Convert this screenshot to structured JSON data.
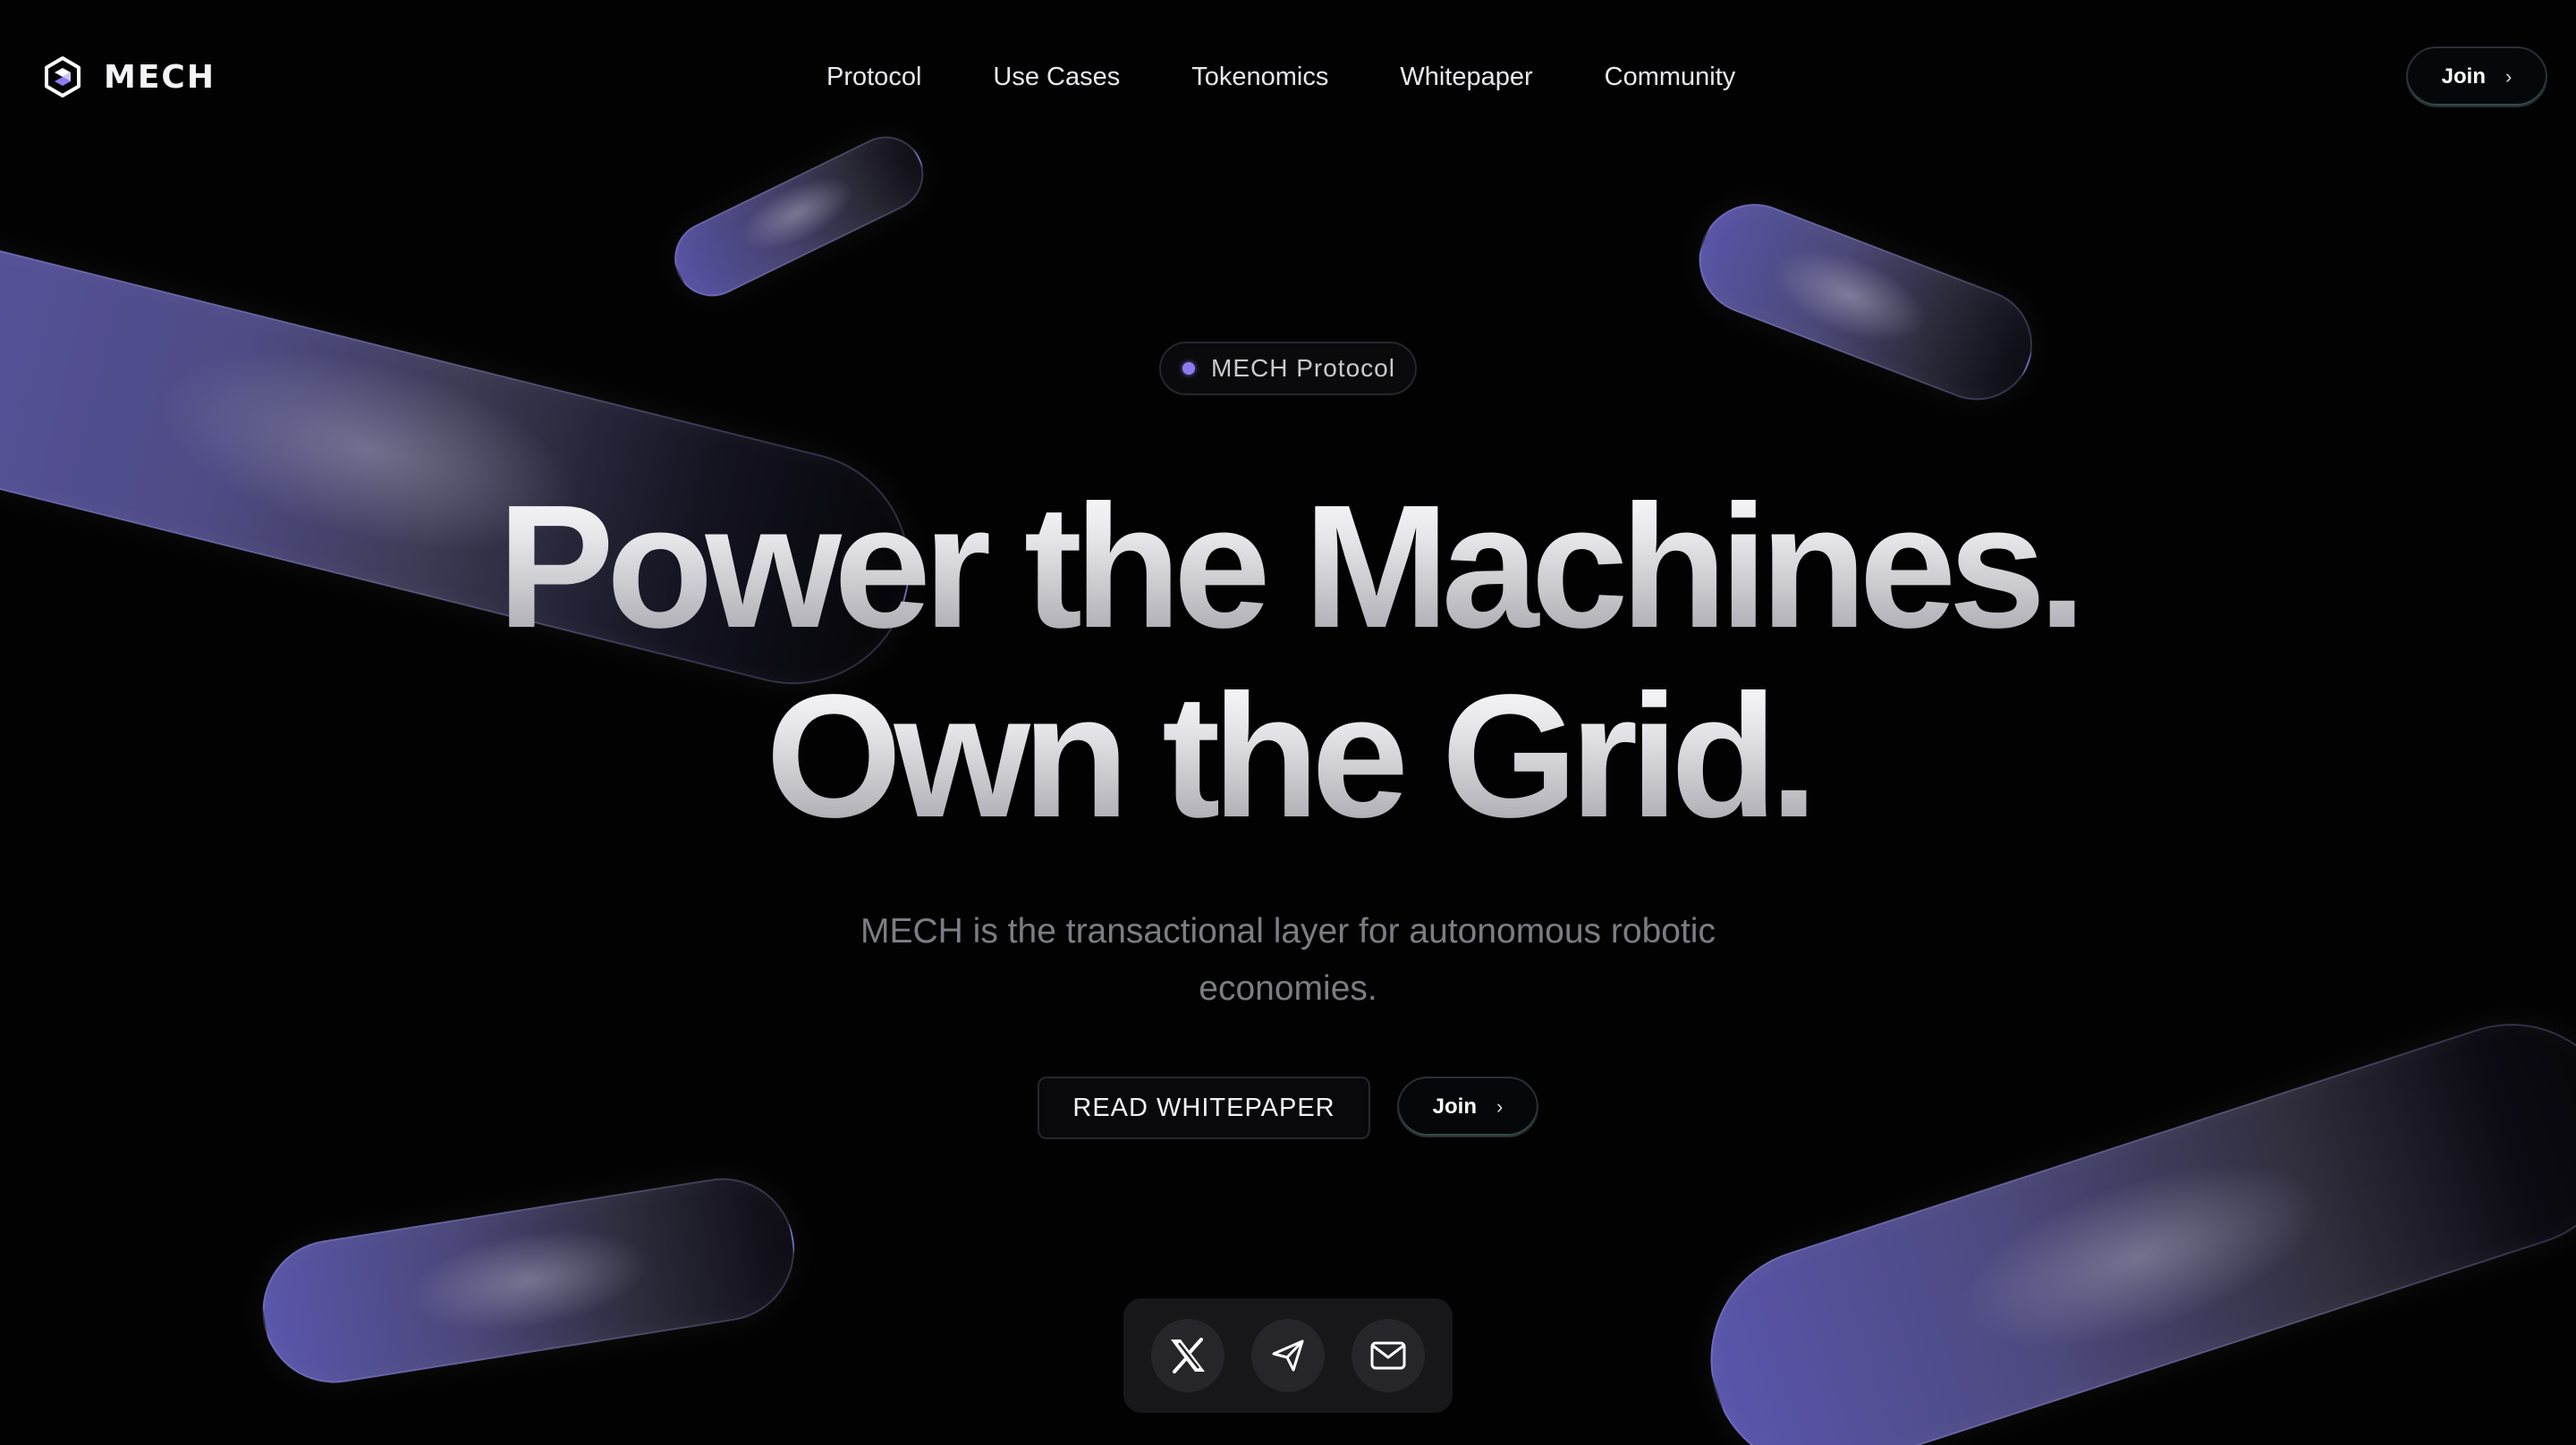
{
  "brand": {
    "name": "MECH",
    "logo_icon": "mech-hexagon-logo-icon"
  },
  "nav": {
    "links": [
      {
        "label": "Protocol"
      },
      {
        "label": "Use Cases"
      },
      {
        "label": "Tokenomics"
      },
      {
        "label": "Whitepaper"
      },
      {
        "label": "Community"
      }
    ],
    "join_label": "Join",
    "join_icon": "chevron-right-icon"
  },
  "hero": {
    "badge": "MECH Protocol",
    "headline_line1": "Power the Machines.",
    "headline_line2": "Own the Grid.",
    "subtitle": "MECH is the transactional layer for autonomous robotic economies.",
    "cta_primary": "READ WHITEPAPER",
    "cta_join": "Join"
  },
  "social": {
    "items": [
      {
        "icon": "x-twitter-icon"
      },
      {
        "icon": "telegram-icon"
      },
      {
        "icon": "mail-icon"
      }
    ]
  },
  "colors": {
    "background": "#020203",
    "accent_purple": "#8d7cf0",
    "pill_purple": "#5753a0",
    "join_glow": "#78d2be"
  }
}
